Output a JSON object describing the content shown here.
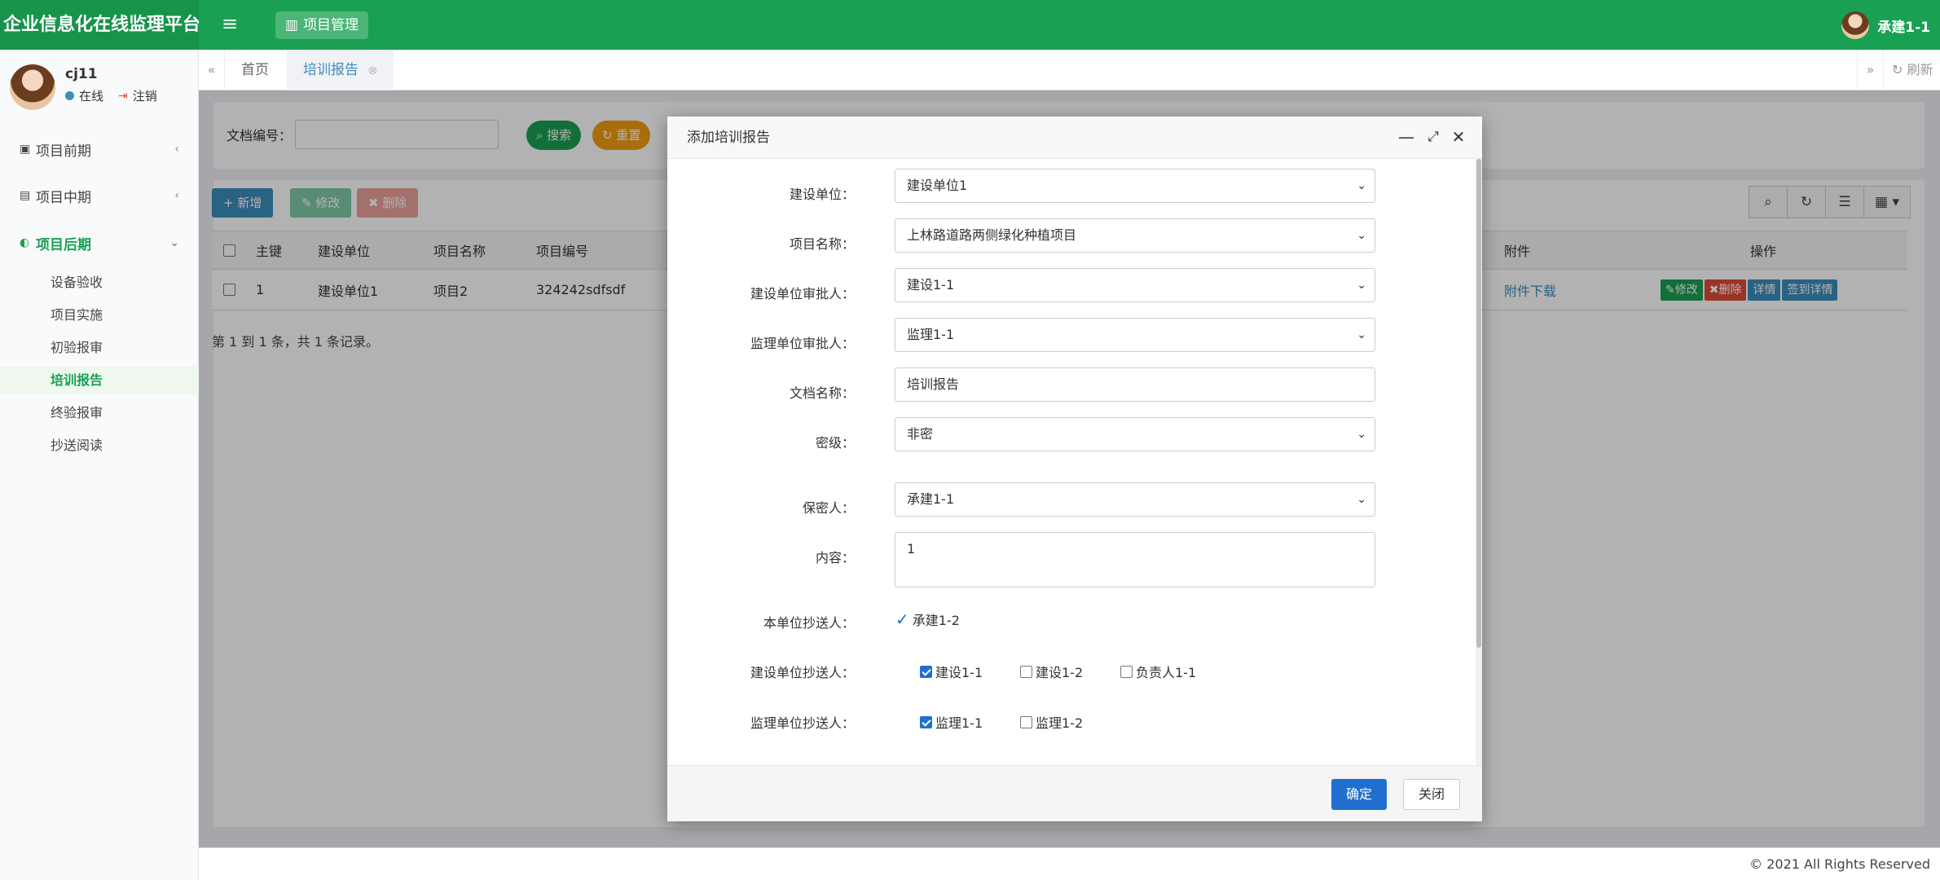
{
  "app": {
    "title": "企业信息化在线监理平台",
    "module": "项目管理",
    "user": "承建1-1"
  },
  "sidebar": {
    "user_name": "cj11",
    "status": "在线",
    "logout": "注销",
    "groups": [
      {
        "label": "项目前期"
      },
      {
        "label": "项目中期"
      },
      {
        "label": "项目后期"
      }
    ],
    "subitems": [
      {
        "label": "设备验收"
      },
      {
        "label": "项目实施"
      },
      {
        "label": "初验报审"
      },
      {
        "label": "培训报告"
      },
      {
        "label": "终验报审"
      },
      {
        "label": "抄送阅读"
      }
    ]
  },
  "tabs": [
    {
      "label": "首页"
    },
    {
      "label": "培训报告"
    }
  ],
  "refresh_label": "刷新",
  "search": {
    "label": "文档编号：",
    "search_btn": "搜索",
    "reset_btn": "重置"
  },
  "toolbar": {
    "add": "新增",
    "edit": "修改",
    "delete": "删除"
  },
  "table": {
    "headers": {
      "id": "主键",
      "unit": "建设单位",
      "project": "项目名称",
      "code": "项目编号",
      "attach": "附件",
      "ops": "操作"
    },
    "rows": [
      {
        "id": "1",
        "unit": "建设单位1",
        "project": "项目2",
        "code": "324242sdfsdf",
        "attach": "附件下载",
        "op_edit": "修改",
        "op_delete": "删除",
        "op_detail": "详情",
        "op_sign": "签到详情"
      }
    ],
    "pager": "第 1 到 1 条，共 1 条记录。"
  },
  "modal": {
    "title": "添加培训报告",
    "fields": {
      "unit_label": "建设单位：",
      "unit_value": "建设单位1",
      "project_label": "项目名称：",
      "project_value": "上林路道路两侧绿化种植项目",
      "unit_approver_label": "建设单位审批人：",
      "unit_approver_value": "建设1-1",
      "sup_approver_label": "监理单位审批人：",
      "sup_approver_value": "监理1-1",
      "doc_name_label": "文档名称：",
      "doc_name_value": "培训报告",
      "secret_label": "密级：",
      "secret_value": "非密",
      "keeper_label": "保密人：",
      "keeper_value": "承建1-1",
      "content_label": "内容：",
      "content_value": "1",
      "own_cc_label": "本单位抄送人：",
      "own_cc_value": "承建1-2",
      "unit_cc_label": "建设单位抄送人：",
      "unit_cc": [
        "建设1-1",
        "建设1-2",
        "负责人1-1"
      ],
      "sup_cc_label": "监理单位抄送人：",
      "sup_cc": [
        "监理1-1",
        "监理1-2"
      ]
    },
    "ok": "确定",
    "close": "关闭"
  },
  "footer": "© 2021 All Rights Reserved",
  "colors": {
    "brand": "#1aa053",
    "primary": "#3c8dbc",
    "danger": "#dd4b39",
    "ok": "#1f6fd1"
  }
}
